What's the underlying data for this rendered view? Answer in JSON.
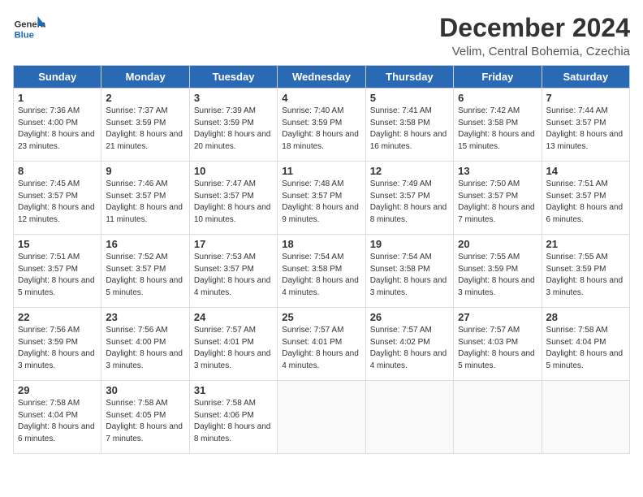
{
  "header": {
    "logo_general": "General",
    "logo_blue": "Blue",
    "month_title": "December 2024",
    "location": "Velim, Central Bohemia, Czechia"
  },
  "weekdays": [
    "Sunday",
    "Monday",
    "Tuesday",
    "Wednesday",
    "Thursday",
    "Friday",
    "Saturday"
  ],
  "weeks": [
    [
      {
        "day": "1",
        "sunrise": "7:36 AM",
        "sunset": "4:00 PM",
        "daylight": "8 hours and 23 minutes."
      },
      {
        "day": "2",
        "sunrise": "7:37 AM",
        "sunset": "3:59 PM",
        "daylight": "8 hours and 21 minutes."
      },
      {
        "day": "3",
        "sunrise": "7:39 AM",
        "sunset": "3:59 PM",
        "daylight": "8 hours and 20 minutes."
      },
      {
        "day": "4",
        "sunrise": "7:40 AM",
        "sunset": "3:59 PM",
        "daylight": "8 hours and 18 minutes."
      },
      {
        "day": "5",
        "sunrise": "7:41 AM",
        "sunset": "3:58 PM",
        "daylight": "8 hours and 16 minutes."
      },
      {
        "day": "6",
        "sunrise": "7:42 AM",
        "sunset": "3:58 PM",
        "daylight": "8 hours and 15 minutes."
      },
      {
        "day": "7",
        "sunrise": "7:44 AM",
        "sunset": "3:57 PM",
        "daylight": "8 hours and 13 minutes."
      }
    ],
    [
      {
        "day": "8",
        "sunrise": "7:45 AM",
        "sunset": "3:57 PM",
        "daylight": "8 hours and 12 minutes."
      },
      {
        "day": "9",
        "sunrise": "7:46 AM",
        "sunset": "3:57 PM",
        "daylight": "8 hours and 11 minutes."
      },
      {
        "day": "10",
        "sunrise": "7:47 AM",
        "sunset": "3:57 PM",
        "daylight": "8 hours and 10 minutes."
      },
      {
        "day": "11",
        "sunrise": "7:48 AM",
        "sunset": "3:57 PM",
        "daylight": "8 hours and 9 minutes."
      },
      {
        "day": "12",
        "sunrise": "7:49 AM",
        "sunset": "3:57 PM",
        "daylight": "8 hours and 8 minutes."
      },
      {
        "day": "13",
        "sunrise": "7:50 AM",
        "sunset": "3:57 PM",
        "daylight": "8 hours and 7 minutes."
      },
      {
        "day": "14",
        "sunrise": "7:51 AM",
        "sunset": "3:57 PM",
        "daylight": "8 hours and 6 minutes."
      }
    ],
    [
      {
        "day": "15",
        "sunrise": "7:51 AM",
        "sunset": "3:57 PM",
        "daylight": "8 hours and 5 minutes."
      },
      {
        "day": "16",
        "sunrise": "7:52 AM",
        "sunset": "3:57 PM",
        "daylight": "8 hours and 5 minutes."
      },
      {
        "day": "17",
        "sunrise": "7:53 AM",
        "sunset": "3:57 PM",
        "daylight": "8 hours and 4 minutes."
      },
      {
        "day": "18",
        "sunrise": "7:54 AM",
        "sunset": "3:58 PM",
        "daylight": "8 hours and 4 minutes."
      },
      {
        "day": "19",
        "sunrise": "7:54 AM",
        "sunset": "3:58 PM",
        "daylight": "8 hours and 3 minutes."
      },
      {
        "day": "20",
        "sunrise": "7:55 AM",
        "sunset": "3:59 PM",
        "daylight": "8 hours and 3 minutes."
      },
      {
        "day": "21",
        "sunrise": "7:55 AM",
        "sunset": "3:59 PM",
        "daylight": "8 hours and 3 minutes."
      }
    ],
    [
      {
        "day": "22",
        "sunrise": "7:56 AM",
        "sunset": "3:59 PM",
        "daylight": "8 hours and 3 minutes."
      },
      {
        "day": "23",
        "sunrise": "7:56 AM",
        "sunset": "4:00 PM",
        "daylight": "8 hours and 3 minutes."
      },
      {
        "day": "24",
        "sunrise": "7:57 AM",
        "sunset": "4:01 PM",
        "daylight": "8 hours and 3 minutes."
      },
      {
        "day": "25",
        "sunrise": "7:57 AM",
        "sunset": "4:01 PM",
        "daylight": "8 hours and 4 minutes."
      },
      {
        "day": "26",
        "sunrise": "7:57 AM",
        "sunset": "4:02 PM",
        "daylight": "8 hours and 4 minutes."
      },
      {
        "day": "27",
        "sunrise": "7:57 AM",
        "sunset": "4:03 PM",
        "daylight": "8 hours and 5 minutes."
      },
      {
        "day": "28",
        "sunrise": "7:58 AM",
        "sunset": "4:04 PM",
        "daylight": "8 hours and 5 minutes."
      }
    ],
    [
      {
        "day": "29",
        "sunrise": "7:58 AM",
        "sunset": "4:04 PM",
        "daylight": "8 hours and 6 minutes."
      },
      {
        "day": "30",
        "sunrise": "7:58 AM",
        "sunset": "4:05 PM",
        "daylight": "8 hours and 7 minutes."
      },
      {
        "day": "31",
        "sunrise": "7:58 AM",
        "sunset": "4:06 PM",
        "daylight": "8 hours and 8 minutes."
      },
      null,
      null,
      null,
      null
    ]
  ]
}
